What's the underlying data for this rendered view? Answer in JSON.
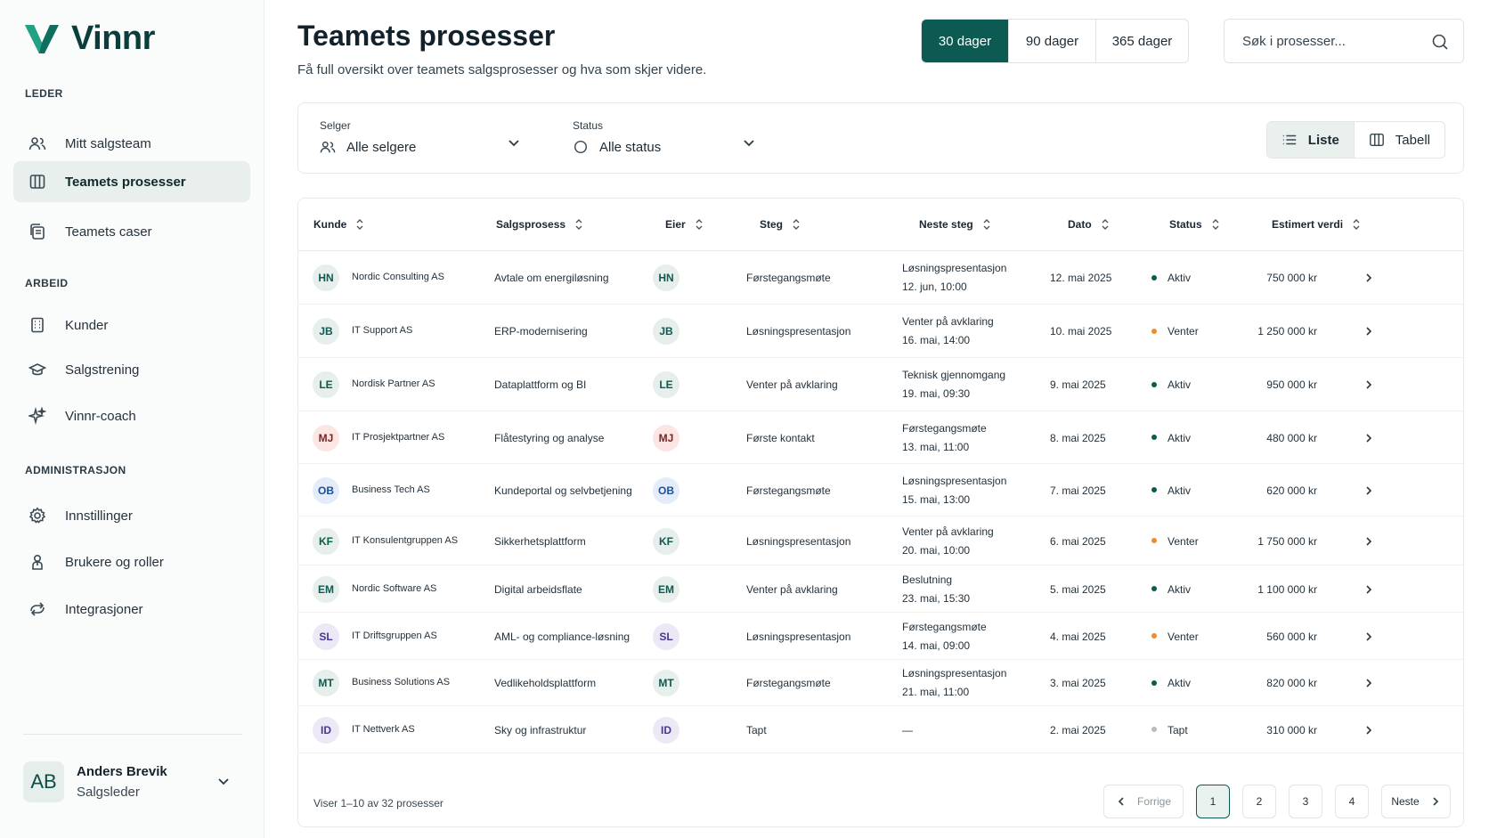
{
  "app": {
    "name": "Vinnr"
  },
  "sidebar": {
    "sections": [
      {
        "title": "LEDER",
        "items": [
          {
            "label": "Mitt salgsteam",
            "icon": "users-icon",
            "active": false
          },
          {
            "label": "Teamets prosesser",
            "icon": "columns-icon",
            "active": true
          },
          {
            "label": "Teamets caser",
            "icon": "copy-icon",
            "active": false
          }
        ]
      },
      {
        "title": "ARBEID",
        "items": [
          {
            "label": "Kunder",
            "icon": "building-icon",
            "active": false
          },
          {
            "label": "Salgstrening",
            "icon": "graduation-cap-icon",
            "active": false
          },
          {
            "label": "Vinnr-coach",
            "icon": "sparkles-icon",
            "active": false
          }
        ]
      },
      {
        "title": "ADMINISTRASJON",
        "items": [
          {
            "label": "Innstillinger",
            "icon": "gear-icon",
            "active": false
          },
          {
            "label": "Brukere og roller",
            "icon": "user-badge-icon",
            "active": false
          },
          {
            "label": "Integrasjoner",
            "icon": "integration-icon",
            "active": false
          }
        ]
      }
    ],
    "user": {
      "initials": "AB",
      "name": "Anders Brevik",
      "role": "Salgsleder"
    }
  },
  "header": {
    "title": "Teamets prosesser",
    "subtitle": "Få full oversikt over teamets salgsprosesser og hva som skjer videre.",
    "ranges": [
      {
        "label": "30 dager",
        "active": true
      },
      {
        "label": "90 dager",
        "active": false
      },
      {
        "label": "365 dager",
        "active": false
      }
    ],
    "search_placeholder": "Søk i prosesser..."
  },
  "filters": {
    "seller": {
      "label": "Selger",
      "value": "Alle selgere"
    },
    "status": {
      "label": "Status",
      "value": "Alle status"
    },
    "views": [
      {
        "label": "Liste",
        "active": true
      },
      {
        "label": "Tabell",
        "active": false
      }
    ]
  },
  "table": {
    "columns": [
      "Kunde",
      "Salgsprosess",
      "Eier",
      "Steg",
      "Neste steg",
      "Dato",
      "Status",
      "Estimert verdi"
    ],
    "rows": [
      {
        "initials": "HN",
        "customer": "Nordic Consulting AS",
        "process": "Avtale om energiløsning",
        "stage": "Førstegangsmøte",
        "next": "Løsningspresentasjon",
        "next_time": "12. jun, 10:00",
        "date": "12. mai 2025",
        "status": "Aktiv",
        "value": "750 000 kr",
        "tone": "green"
      },
      {
        "initials": "JB",
        "customer": "IT Support AS",
        "process": "ERP-modernisering",
        "stage": "Løsningspresentasjon",
        "next": "Venter på avklaring",
        "next_time": "16. mai, 14:00",
        "date": "10. mai 2025",
        "status": "Venter",
        "value": "1 250 000 kr",
        "tone": "green"
      },
      {
        "initials": "LE",
        "customer": "Nordisk Partner AS",
        "process": "Dataplattform og BI",
        "stage": "Venter på avklaring",
        "next": "Teknisk gjennomgang",
        "next_time": "19. mai, 09:30",
        "date": "9. mai 2025",
        "status": "Aktiv",
        "value": "950 000 kr",
        "tone": "green"
      },
      {
        "initials": "MJ",
        "customer": "IT Prosjektpartner AS",
        "process": "Flåtestyring og analyse",
        "stage": "Første kontakt",
        "next": "Førstegangsmøte",
        "next_time": "13. mai, 11:00",
        "date": "8. mai 2025",
        "status": "Aktiv",
        "value": "480 000 kr",
        "tone": "pink"
      },
      {
        "initials": "OB",
        "customer": "Business Tech AS",
        "process": "Kundeportal og selvbetjening",
        "stage": "Førstegangsmøte",
        "next": "Løsningspresentasjon",
        "next_time": "15. mai, 13:00",
        "date": "7. mai 2025",
        "status": "Aktiv",
        "value": "620 000 kr",
        "tone": "blue"
      },
      {
        "initials": "KF",
        "customer": "IT Konsulentgruppen AS",
        "process": "Sikkerhetsplattform",
        "stage": "Løsningspresentasjon",
        "next": "Venter på avklaring",
        "next_time": "20. mai, 10:00",
        "date": "6. mai 2025",
        "status": "Venter",
        "value": "1 750 000 kr",
        "tone": "green"
      },
      {
        "initials": "EM",
        "customer": "Nordic Software AS",
        "process": "Digital arbeidsflate",
        "stage": "Venter på avklaring",
        "next": "Beslutning",
        "next_time": "23. mai, 15:30",
        "date": "5. mai 2025",
        "status": "Aktiv",
        "value": "1 100 000 kr",
        "tone": "green"
      },
      {
        "initials": "SL",
        "customer": "IT Driftsgruppen AS",
        "process": "AML- og compliance-løsning",
        "stage": "Løsningspresentasjon",
        "next": "Førstegangsmøte",
        "next_time": "14. mai, 09:00",
        "date": "4. mai 2025",
        "status": "Venter",
        "value": "560 000 kr",
        "tone": "purple"
      },
      {
        "initials": "MT",
        "customer": "Business Solutions AS",
        "process": "Vedlikeholdsplattform",
        "stage": "Førstegangsmøte",
        "next": "Løsningspresentasjon",
        "next_time": "21. mai, 11:00",
        "date": "3. mai 2025",
        "status": "Aktiv",
        "value": "820 000 kr",
        "tone": "green"
      },
      {
        "initials": "ID",
        "customer": "IT Nettverk AS",
        "process": "Sky og infrastruktur",
        "stage": "Tapt",
        "next": "—",
        "next_time": "",
        "date": "2. mai 2025",
        "status": "Tapt",
        "value": "310 000 kr",
        "tone": "purple"
      }
    ],
    "status_colors": {
      "Aktiv": "#0c5a51",
      "Venter": "#f08a2c",
      "Tapt": "#b6bdc2"
    },
    "footer": "Viser 1–10 av 32 prosesser",
    "pagination": {
      "prev": "Forrige",
      "next": "Neste",
      "pages": [
        "1",
        "2",
        "3",
        "4"
      ],
      "current": "1"
    }
  }
}
